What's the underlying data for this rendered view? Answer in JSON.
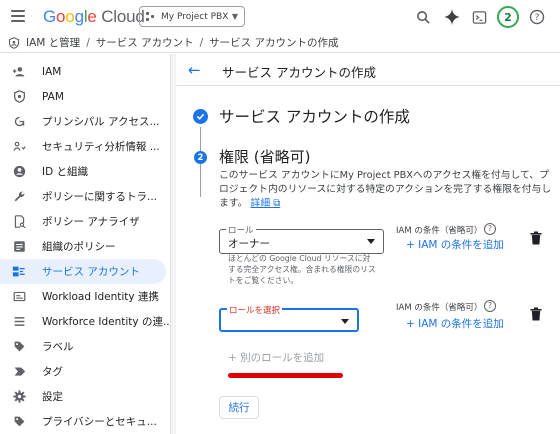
{
  "header": {
    "logo": {
      "g": "G",
      "o1": "o",
      "o2": "o",
      "g2": "g",
      "l": "l",
      "e": "e",
      "cloud": " Cloud"
    },
    "project_label": "My Project PBX",
    "avatar_initial": "2"
  },
  "breadcrumb": {
    "items": [
      "IAM と管理",
      "サービス アカウント",
      "サービス アカウントの作成"
    ],
    "separator": "/"
  },
  "sidebar": {
    "items": [
      {
        "label": "IAM",
        "icon": "person-add-icon"
      },
      {
        "label": "PAM",
        "icon": "shield-icon"
      },
      {
        "label": "プリンシパル アクセス...",
        "icon": "access-icon"
      },
      {
        "label": "セキュリティ分析情報 ...",
        "icon": "insights-icon"
      },
      {
        "label": "ID と組織",
        "icon": "account-circle-icon"
      },
      {
        "label": "ポリシーに関するトラ...",
        "icon": "wrench-icon"
      },
      {
        "label": "ポリシー アナライザ",
        "icon": "analyzer-icon"
      },
      {
        "label": "組織のポリシー",
        "icon": "list-box-icon"
      },
      {
        "label": "サービス アカウント",
        "icon": "service-account-icon",
        "active": true
      },
      {
        "label": "Workload Identity 連携",
        "icon": "card-icon"
      },
      {
        "label": "Workforce Identity の連...",
        "icon": "list-icon"
      },
      {
        "label": "ラベル",
        "icon": "tag-icon"
      },
      {
        "label": "タグ",
        "icon": "chevron-tag-icon"
      },
      {
        "label": "設定",
        "icon": "gear-icon"
      },
      {
        "label": "プライバシーとセキュ...",
        "icon": "privacy-icon"
      }
    ]
  },
  "main": {
    "page_title": "サービス アカウントの作成",
    "step1": {
      "title": "サービス アカウントの作成"
    },
    "step2": {
      "number": "2",
      "title": "権限 (省略可)",
      "description": "このサービス アカウントにMy Project PBXへのアクセス権を付与して、プロジェクト内のリソースに対する特定のアクションを完了する権限を付与します。",
      "link": "詳細"
    },
    "role1": {
      "label": "ロール",
      "value": "オーナー",
      "helper": "ほとんどの Google Cloud リソースに対する完全アクセス権。含まれる権限のリストをご覧ください。",
      "condition_label": "IAM の条件（省略可）",
      "add_condition": "+ IAM の条件を追加"
    },
    "role2": {
      "label": "ロールを選択",
      "value": "",
      "condition_label": "IAM の条件（省略可）",
      "add_condition": "+ IAM の条件を追加"
    },
    "add_role": "+ 別のロールを追加",
    "continue_label": "続行"
  }
}
